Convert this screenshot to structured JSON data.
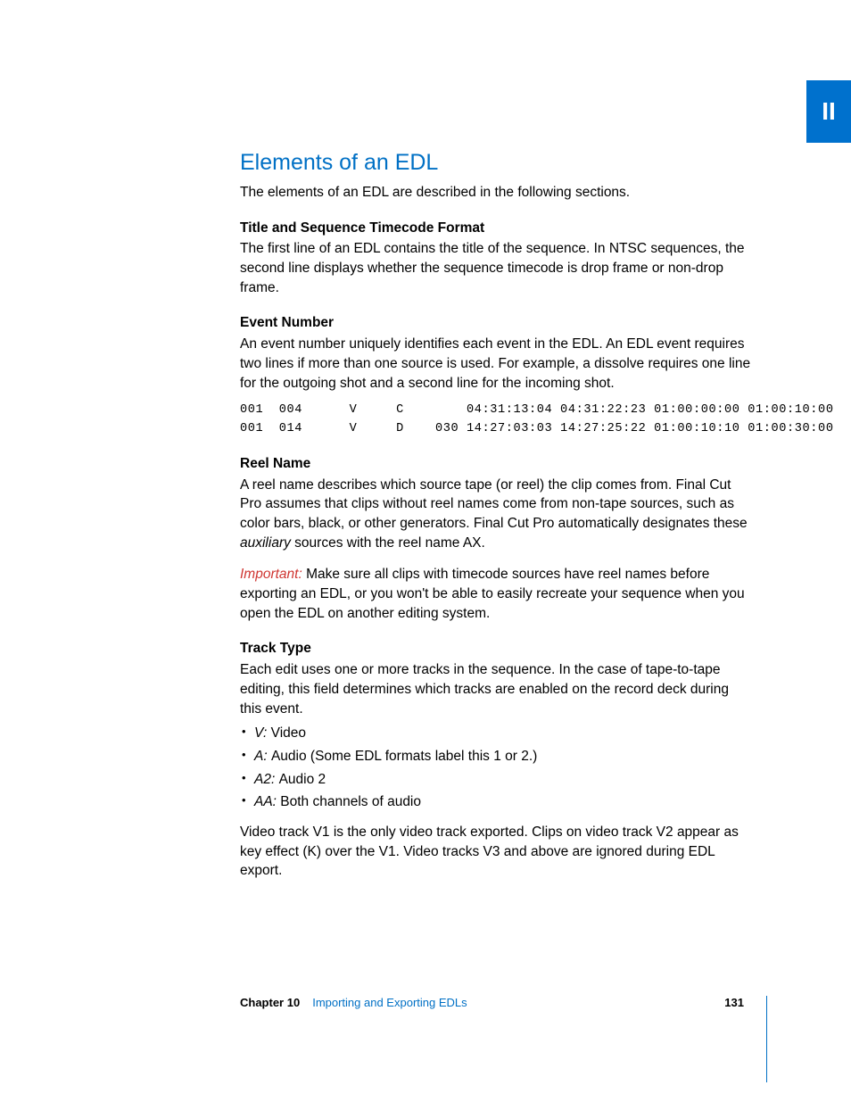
{
  "pageTab": "II",
  "heading": "Elements of an EDL",
  "intro": "The elements of an EDL are described in the following sections.",
  "section1": {
    "title": "Title and Sequence Timecode Format",
    "body": "The first line of an EDL contains the title of the sequence. In NTSC sequences, the second line displays whether the sequence timecode is drop frame or non-drop frame."
  },
  "section2": {
    "title": "Event Number",
    "body": "An event number uniquely identifies each event in the EDL. An EDL event requires two lines if more than one source is used. For example, a dissolve requires one line for the outgoing shot and a second line for the incoming shot.",
    "code": "001  004      V     C        04:31:13:04 04:31:22:23 01:00:00:00 01:00:10:00\n001  014      V     D    030 14:27:03:03 14:27:25:22 01:00:10:10 01:00:30:00"
  },
  "section3": {
    "title": "Reel Name",
    "body_a": "A reel name describes which source tape (or reel) the clip comes from. Final Cut Pro assumes that clips without reel names come from non-tape sources, such as color bars, black, or other generators. Final Cut Pro automatically designates these ",
    "aux": "auxiliary",
    "body_b": " sources with the reel name AX."
  },
  "important": {
    "label": "Important:  ",
    "body": "Make sure all clips with timecode sources have reel names before exporting an EDL, or you won't be able to easily recreate your sequence when you open the EDL on another editing system."
  },
  "section4": {
    "title": "Track Type",
    "body": "Each edit uses one or more tracks in the sequence. In the case of tape-to-tape editing, this field determines which tracks are enabled on the record deck during this event.",
    "items": [
      {
        "term": "V:  ",
        "def": "Video"
      },
      {
        "term": "A:  ",
        "def": "Audio (Some EDL formats label this 1 or 2.)"
      },
      {
        "term": "A2:  ",
        "def": "Audio 2"
      },
      {
        "term": "AA:  ",
        "def": "Both channels of audio"
      }
    ],
    "tail": "Video track V1 is the only video track exported. Clips on video track V2 appear as key effect (K) over the V1. Video tracks V3 and above are ignored during EDL export."
  },
  "footer": {
    "chapter": "Chapter 10",
    "title": "Importing and Exporting EDLs",
    "page": "131"
  }
}
